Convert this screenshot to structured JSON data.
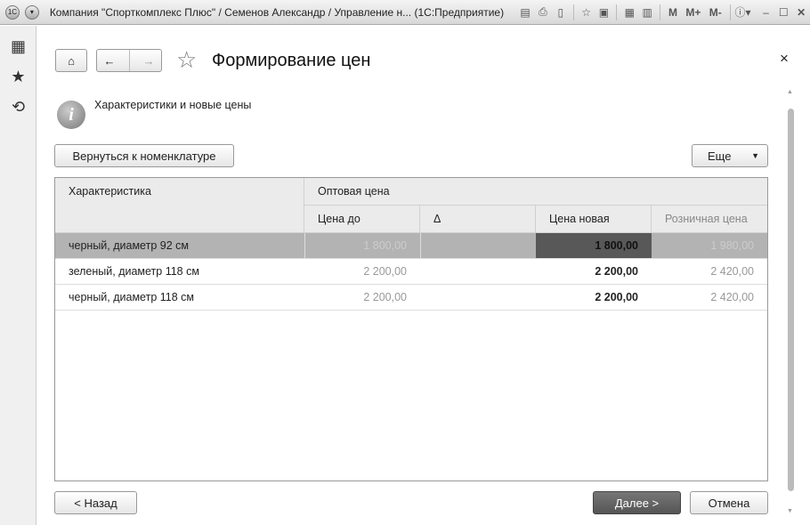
{
  "window": {
    "title": "Компания \"Спорткомплекс Плюс\" / Семенов Александр / Управление н...  (1С:Предприятие)",
    "toolbar": [
      "M",
      "M+",
      "M-"
    ]
  },
  "form": {
    "title": "Формирование цен",
    "info": "Характеристики и новые цены",
    "back_to_nomenclature": "Вернуться к номенклатуре",
    "more": "Еще",
    "close": "×"
  },
  "table": {
    "headers": {
      "characteristic": "Характеристика",
      "wholesale": "Оптовая цена",
      "price_before": "Цена до",
      "delta": "Δ",
      "price_new": "Цена новая",
      "retail": "Розничная цена"
    },
    "rows": [
      {
        "characteristic": "черный, диаметр 92 см",
        "price_before": "1 800,00",
        "delta": "",
        "price_new": "1 800,00",
        "retail": "1 980,00",
        "selected": true
      },
      {
        "characteristic": "зеленый, диаметр 118 см",
        "price_before": "2 200,00",
        "delta": "",
        "price_new": "2 200,00",
        "retail": "2 420,00"
      },
      {
        "characteristic": "черный, диаметр 118 см",
        "price_before": "2 200,00",
        "delta": "",
        "price_new": "2 200,00",
        "retail": "2 420,00"
      }
    ]
  },
  "footer": {
    "back": "< Назад",
    "next": "Далее >",
    "cancel": "Отмена"
  }
}
